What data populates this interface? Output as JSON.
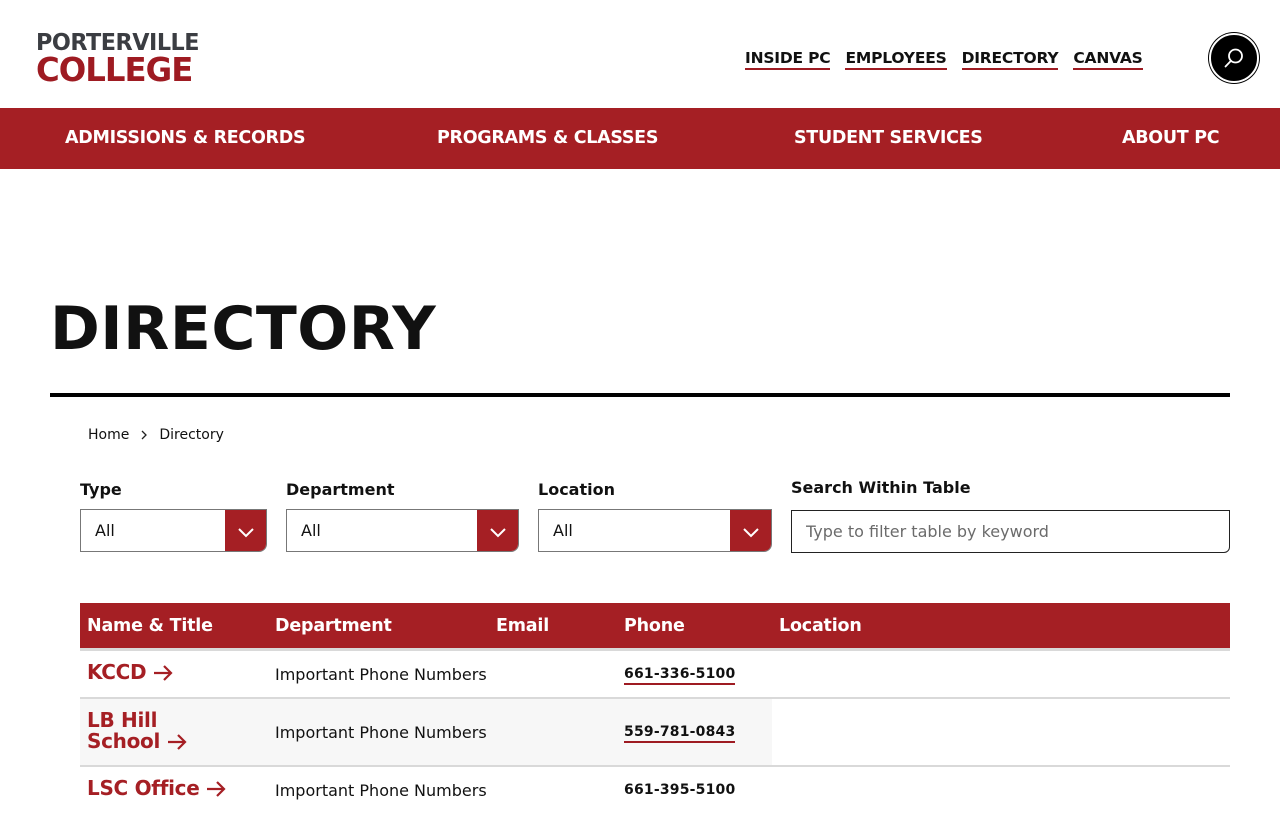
{
  "logo": {
    "line1": "PORTERVILLE",
    "line2": "COLLEGE"
  },
  "utility_nav": [
    "INSIDE PC",
    "EMPLOYEES",
    "DIRECTORY",
    "CANVAS"
  ],
  "main_nav": [
    "ADMISSIONS & RECORDS",
    "PROGRAMS & CLASSES",
    "STUDENT SERVICES",
    "ABOUT PC"
  ],
  "page_title": "DIRECTORY",
  "breadcrumb": {
    "home": "Home",
    "current": "Directory"
  },
  "filters": {
    "type": {
      "label": "Type",
      "value": "All"
    },
    "department": {
      "label": "Department",
      "value": "All"
    },
    "location": {
      "label": "Location",
      "value": "All"
    },
    "search": {
      "label": "Search Within Table",
      "placeholder": "Type to filter table by keyword"
    }
  },
  "table": {
    "headers": [
      "Name & Title",
      "Department",
      "Email",
      "Phone",
      "Location"
    ],
    "rows": [
      {
        "name": "KCCD",
        "department": "Important Phone Numbers",
        "phone": "661-336-5100"
      },
      {
        "name_line1": "LB Hill",
        "name_line2": "School",
        "department": "Important Phone Numbers",
        "phone": "559-781-0843"
      },
      {
        "name": "LSC Office",
        "department": "Important Phone Numbers",
        "phone": "661-395-5100"
      }
    ]
  },
  "colors": {
    "brand_red": "#a51f24",
    "logo_gray": "#3b3d42"
  }
}
